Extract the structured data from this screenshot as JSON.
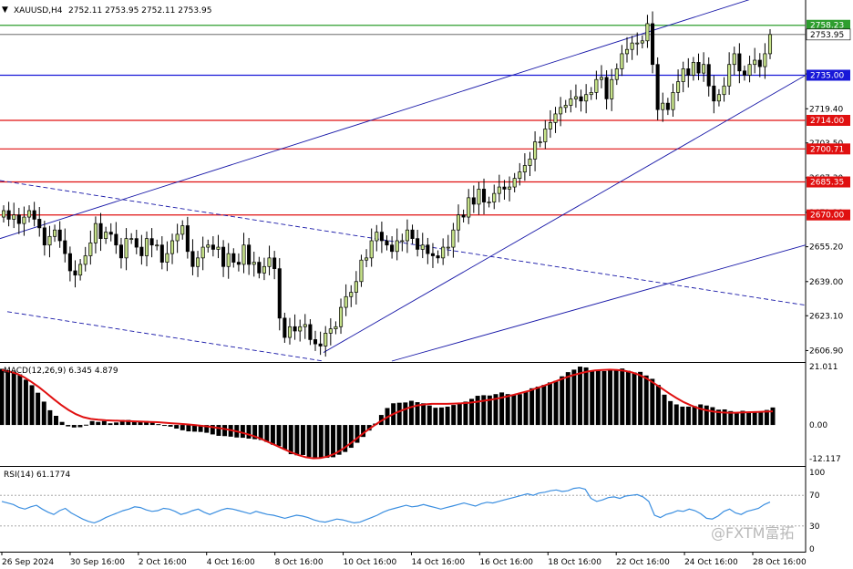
{
  "header": {
    "symbol": "XAUUSD,H4",
    "ohlc": "2752.11 2753.95 2752.11 2753.95",
    "menu_glyph": "▼"
  },
  "macd_label": "MACD(12,26,9) 6.345 4.879",
  "rsi_label": "RSI(14) 61.1774",
  "watermark": "@FXTM富拓",
  "price_axis": {
    "ticks": [
      "2735.60",
      "2719.40",
      "2703.50",
      "2687.30",
      "2671.20",
      "2655.20",
      "2639.00",
      "2623.10",
      "2606.90"
    ],
    "current": "2753.95",
    "levels": [
      {
        "label": "2758.23",
        "value": 2758.23,
        "color": "#2e9e2e"
      },
      {
        "label": "2735.00",
        "value": 2735.0,
        "color": "#1818d8"
      },
      {
        "label": "2714.00",
        "value": 2714.0,
        "color": "#e01010"
      },
      {
        "label": "2700.71",
        "value": 2700.71,
        "color": "#e01010"
      },
      {
        "label": "2685.35",
        "value": 2685.35,
        "color": "#e01010"
      },
      {
        "label": "2670.00",
        "value": 2670.0,
        "color": "#e01010"
      }
    ]
  },
  "macd_axis": {
    "ticks": [
      "21.011",
      "0.00",
      "-12.117"
    ]
  },
  "rsi_axis": {
    "ticks": [
      "100",
      "70",
      "30",
      "0"
    ]
  },
  "time_axis": [
    "26 Sep 2024",
    "30 Sep 16:00",
    "2 Oct 16:00",
    "4 Oct 16:00",
    "8 Oct 16:00",
    "10 Oct 16:00",
    "14 Oct 16:00",
    "16 Oct 16:00",
    "18 Oct 16:00",
    "22 Oct 16:00",
    "24 Oct 16:00",
    "28 Oct 16:00"
  ],
  "colors": {
    "bull_body": "#c7e38a",
    "bear_body": "#000000",
    "trend": "#1818a8",
    "macd_signal": "#e01010",
    "rsi_line": "#3a8ee0"
  },
  "chart_data": [
    {
      "type": "candlestick",
      "name": "XAUUSD,H4",
      "closes": [
        2672,
        2668,
        2670,
        2666,
        2669,
        2672,
        2668,
        2664,
        2656,
        2660,
        2663,
        2658,
        2652,
        2644,
        2642,
        2647,
        2651,
        2657,
        2666,
        2659,
        2662,
        2661,
        2656,
        2650,
        2659,
        2659,
        2655,
        2651,
        2659,
        2656,
        2656,
        2648,
        2652,
        2658,
        2661,
        2665,
        2653,
        2646,
        2650,
        2655,
        2656,
        2654,
        2655,
        2646,
        2652,
        2648,
        2647,
        2656,
        2647,
        2648,
        2643,
        2646,
        2650,
        2645,
        2622,
        2613,
        2618,
        2616,
        2618,
        2619,
        2612,
        2610,
        2609,
        2615,
        2617,
        2618,
        2627,
        2632,
        2634,
        2639,
        2649,
        2650,
        2658,
        2662,
        2658,
        2656,
        2653,
        2658,
        2658,
        2663,
        2659,
        2654,
        2656,
        2652,
        2651,
        2650,
        2655,
        2655,
        2663,
        2670,
        2669,
        2678,
        2675,
        2682,
        2676,
        2676,
        2680,
        2683,
        2682,
        2683,
        2687,
        2690,
        2693,
        2696,
        2704,
        2704,
        2710,
        2713,
        2717,
        2720,
        2721,
        2724,
        2725,
        2723,
        2726,
        2727,
        2733,
        2734,
        2724,
        2733,
        2738,
        2745,
        2747,
        2750,
        2750,
        2751,
        2759,
        2740,
        2719,
        2722,
        2719,
        2727,
        2732,
        2738,
        2735,
        2741,
        2736,
        2740,
        2730,
        2723,
        2726,
        2730,
        2740,
        2745,
        2737,
        2735,
        2740,
        2742,
        2739,
        2745,
        2753.95
      ],
      "levels": [
        2758.23,
        2735.0,
        2714.0,
        2700.71,
        2685.35,
        2670.0
      ],
      "ylim": [
        2602,
        2770
      ]
    },
    {
      "type": "bar",
      "name": "MACD(12,26,9)",
      "values": [
        20.2,
        19.7,
        19.2,
        18.2,
        16.3,
        14.3,
        11.6,
        8.4,
        5.3,
        3.3,
        1.1,
        -0.5,
        -0.9,
        -0.8,
        0.1,
        1.4,
        1.1,
        1.4,
        0.6,
        0.9,
        1.8,
        1.8,
        1.1,
        1.1,
        1.4,
        1.2,
        0.3,
        -0.3,
        -0.6,
        -1.3,
        -1.9,
        -2.3,
        -2.4,
        -2.5,
        -2.8,
        -3.4,
        -3.9,
        -4.0,
        -4.2,
        -4.5,
        -4.6,
        -4.9,
        -5.1,
        -5.4,
        -6.1,
        -7.1,
        -7.6,
        -8.8,
        -10.5,
        -10.9,
        -10.8,
        -11.5,
        -11.7,
        -11.9,
        -11.8,
        -11.6,
        -10.7,
        -9.7,
        -8.2,
        -6.4,
        -4.3,
        -2.0,
        0.5,
        3.6,
        6.1,
        7.8,
        8.0,
        8.1,
        8.7,
        8.2,
        7.8,
        7.0,
        6.2,
        6.3,
        6.6,
        7.2,
        7.9,
        8.4,
        9.4,
        10.5,
        10.7,
        10.6,
        11.1,
        11.7,
        11.1,
        11.0,
        11.1,
        11.9,
        13.2,
        13.8,
        14.4,
        15.3,
        15.9,
        17.5,
        19.0,
        19.9,
        21.0,
        20.7,
        19.4,
        19.7,
        19.4,
        19.7,
        19.6,
        20.3,
        19.5,
        18.9,
        19.1,
        17.8,
        16.6,
        14.4,
        10.9,
        8.6,
        7.4,
        6.6,
        6.6,
        6.8,
        7.4,
        7.0,
        6.4,
        5.5,
        5.6,
        5.0,
        4.6,
        5.1,
        4.7,
        4.9,
        4.9,
        5.4,
        6.3
      ],
      "signal": [
        19.8,
        19.2,
        18.5,
        17.2,
        15.5,
        13.6,
        11.5,
        9.3,
        7.2,
        5.4,
        3.9,
        2.8,
        2.2,
        1.9,
        1.7,
        1.6,
        1.5,
        1.4,
        1.3,
        1.2,
        1.1,
        1.0,
        0.8,
        0.6,
        0.4,
        0.2,
        0.0,
        -0.3,
        -0.6,
        -1.0,
        -1.4,
        -1.9,
        -2.5,
        -3.2,
        -4.0,
        -5.0,
        -6.2,
        -7.4,
        -8.6,
        -9.8,
        -10.8,
        -11.6,
        -12.0,
        -11.9,
        -11.3,
        -10.2,
        -8.6,
        -6.7,
        -4.6,
        -2.5,
        -0.6,
        1.2,
        2.8,
        4.2,
        5.3,
        6.3,
        7.0,
        7.4,
        7.6,
        7.6,
        7.6,
        7.7,
        7.8,
        8.0,
        8.3,
        8.7,
        9.1,
        9.6,
        10.2,
        10.8,
        11.5,
        12.2,
        13.1,
        14.0,
        15.0,
        16.0,
        17.0,
        17.9,
        18.6,
        19.2,
        19.6,
        19.8,
        19.9,
        19.8,
        19.5,
        18.9,
        18.0,
        16.7,
        15.0,
        13.2,
        11.4,
        9.7,
        8.2,
        7.0,
        6.0,
        5.3,
        4.8,
        4.5,
        4.4,
        4.4,
        4.5,
        4.6,
        4.7,
        4.8,
        4.9
      ],
      "ylim": [
        -12.117,
        21.011
      ]
    },
    {
      "type": "line",
      "name": "RSI(14)",
      "values": [
        62,
        60,
        58,
        54,
        52,
        55,
        57,
        52,
        48,
        45,
        50,
        53,
        47,
        43,
        39,
        36,
        34,
        37,
        41,
        44,
        47,
        50,
        52,
        55,
        54,
        51,
        49,
        50,
        53,
        52,
        49,
        45,
        47,
        50,
        52,
        48,
        45,
        48,
        51,
        53,
        52,
        50,
        48,
        46,
        49,
        47,
        45,
        44,
        42,
        40,
        42,
        44,
        43,
        41,
        38,
        36,
        35,
        37,
        39,
        38,
        36,
        34,
        35,
        38,
        41,
        44,
        48,
        51,
        53,
        55,
        57,
        55,
        56,
        58,
        56,
        54,
        52,
        54,
        56,
        58,
        60,
        58,
        56,
        59,
        61,
        60,
        62,
        64,
        66,
        68,
        70,
        72,
        70,
        73,
        74,
        76,
        77,
        75,
        76,
        79,
        80,
        78,
        66,
        62,
        64,
        67,
        68,
        66,
        69,
        70,
        71,
        68,
        62,
        44,
        41,
        45,
        47,
        50,
        49,
        52,
        50,
        46,
        40,
        39,
        43,
        49,
        52,
        47,
        45,
        49,
        51,
        53,
        58,
        61.1774
      ],
      "levels": [
        30,
        70
      ],
      "ylim": [
        0,
        100
      ]
    }
  ]
}
